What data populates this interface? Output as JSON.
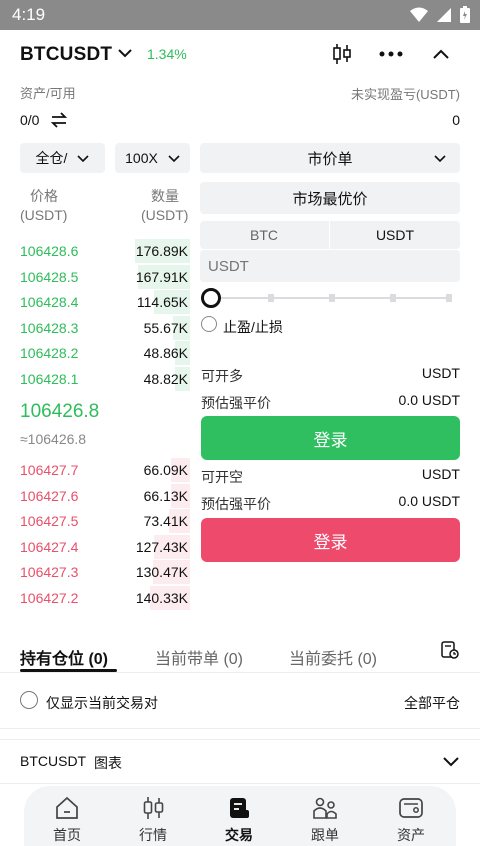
{
  "status": {
    "time": "4:19"
  },
  "header": {
    "pair": "BTCUSDT",
    "change": "1.34%"
  },
  "account": {
    "assets_label": "资产/可用",
    "assets_value": "0/0",
    "pnl_label": "未实现盈亏(USDT)",
    "pnl_value": "0"
  },
  "controls": {
    "margin_mode": "全仓/",
    "leverage": "100X",
    "order_type": "市价单",
    "price_mode": "市场最优价",
    "unit_tabs": [
      "BTC",
      "USDT"
    ],
    "amount_placeholder": "USDT",
    "tpsl_label": "止盈/止损"
  },
  "orderbook": {
    "price_header": "价格",
    "price_unit": "(USDT)",
    "qty_header": "数量",
    "qty_unit": "(USDT)",
    "bids": [
      {
        "price": "106428.6",
        "qty": "176.89K",
        "depth": 1.0
      },
      {
        "price": "106428.5",
        "qty": "167.91K",
        "depth": 0.95
      },
      {
        "price": "106428.4",
        "qty": "114.65K",
        "depth": 0.65
      },
      {
        "price": "106428.3",
        "qty": "55.67K",
        "depth": 0.31
      },
      {
        "price": "106428.2",
        "qty": "48.86K",
        "depth": 0.28
      },
      {
        "price": "106428.1",
        "qty": "48.82K",
        "depth": 0.27
      }
    ],
    "last_price": "106426.8",
    "mark_price": "≈106426.8",
    "asks": [
      {
        "price": "106427.7",
        "qty": "66.09K",
        "depth": 0.34
      },
      {
        "price": "106427.6",
        "qty": "66.13K",
        "depth": 0.34
      },
      {
        "price": "106427.5",
        "qty": "73.41K",
        "depth": 0.38
      },
      {
        "price": "106427.4",
        "qty": "127.43K",
        "depth": 0.66
      },
      {
        "price": "106427.3",
        "qty": "130.47K",
        "depth": 0.67
      },
      {
        "price": "106427.2",
        "qty": "140.33K",
        "depth": 0.72
      }
    ]
  },
  "long": {
    "avail_label": "可开多",
    "avail_value": "USDT",
    "liq_label": "预估强平价",
    "liq_value": "0.0 USDT",
    "button": "登录"
  },
  "short": {
    "avail_label": "可开空",
    "avail_value": "USDT",
    "liq_label": "预估强平价",
    "liq_value": "0.0 USDT",
    "button": "登录"
  },
  "positions": {
    "tabs": [
      "持有仓位 (0)",
      "当前带单 (0)",
      "当前委托 (0)"
    ],
    "filter_label": "仅显示当前交易对",
    "close_all": "全部平仓"
  },
  "chart_row": {
    "pair": "BTCUSDT",
    "label": "图表"
  },
  "nav": [
    "首页",
    "行情",
    "交易",
    "跟单",
    "资产"
  ],
  "colors": {
    "green": "#2fbf61",
    "red": "#ee4a6c",
    "status_bar": "#8a8a8a"
  }
}
